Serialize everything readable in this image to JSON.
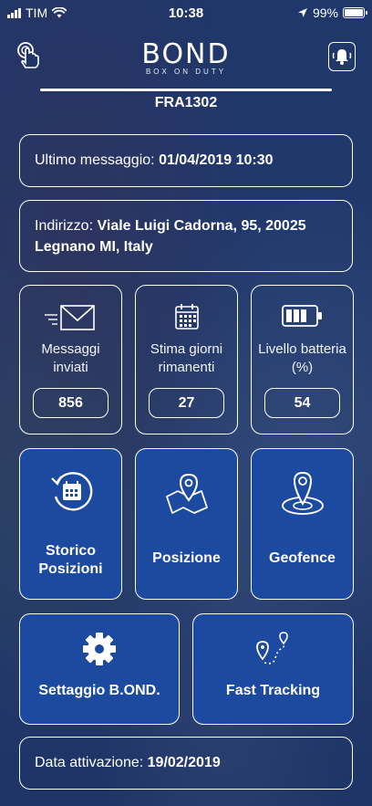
{
  "status_bar": {
    "carrier": "TIM",
    "time": "10:38",
    "battery": "99%"
  },
  "header": {
    "logo_text": "BOND",
    "logo_subtitle": "BOX ON DUTY",
    "device_id": "FRA1302"
  },
  "last_message": {
    "label": "Ultimo messaggio:",
    "value": "01/04/2019 10:30"
  },
  "address": {
    "label": "Indirizzo:",
    "value": "Viale Luigi Cadorna, 95, 20025 Legnano MI, Italy"
  },
  "stats": [
    {
      "icon": "envelope-icon",
      "label": "Messaggi inviati",
      "value": "856"
    },
    {
      "icon": "calendar-icon",
      "label": "Stima giorni rimanenti",
      "value": "27"
    },
    {
      "icon": "battery-level-icon",
      "label": "Livello batteria (%)",
      "value": "54"
    }
  ],
  "actions": {
    "history": "Storico Posizioni",
    "position": "Posizione",
    "geofence": "Geofence",
    "settings": "Settaggio B.OND.",
    "fast_tracking": "Fast Tracking"
  },
  "activation": {
    "label": "Data attivazione:",
    "value": "19/02/2019"
  },
  "colors": {
    "action_button": "#1c4aa0",
    "background_overlay": "#1f3564"
  }
}
